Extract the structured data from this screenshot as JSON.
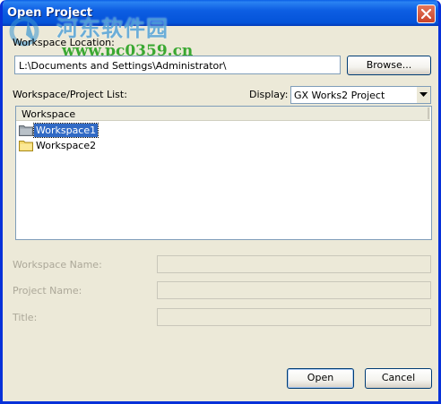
{
  "window": {
    "title": "Open Project"
  },
  "watermark": {
    "site_name": "河东软件园",
    "url": "www.pc0359.cn"
  },
  "workspace_location": {
    "label": "Workspace Location:",
    "value": "L:\\Documents and Settings\\Administrator\\",
    "browse_button": "Browse..."
  },
  "list_section": {
    "label": "Workspace/Project List:",
    "display_label": "Display:",
    "display_value": "GX Works2 Project",
    "column_header": "Workspace",
    "items": [
      {
        "label": "Workspace1",
        "selected": true
      },
      {
        "label": "Workspace2",
        "selected": false
      }
    ]
  },
  "fields": {
    "workspace_name_label": "Workspace Name:",
    "project_name_label": "Project Name:",
    "title_label": "Title:"
  },
  "buttons": {
    "open": "Open",
    "cancel": "Cancel"
  },
  "colors": {
    "titlebar": "#0453d8",
    "dialog_bg": "#ece9d8",
    "selection": "#316ac5",
    "folder_yellow": "#f3d76b",
    "folder_grey": "#9aa3ab"
  }
}
